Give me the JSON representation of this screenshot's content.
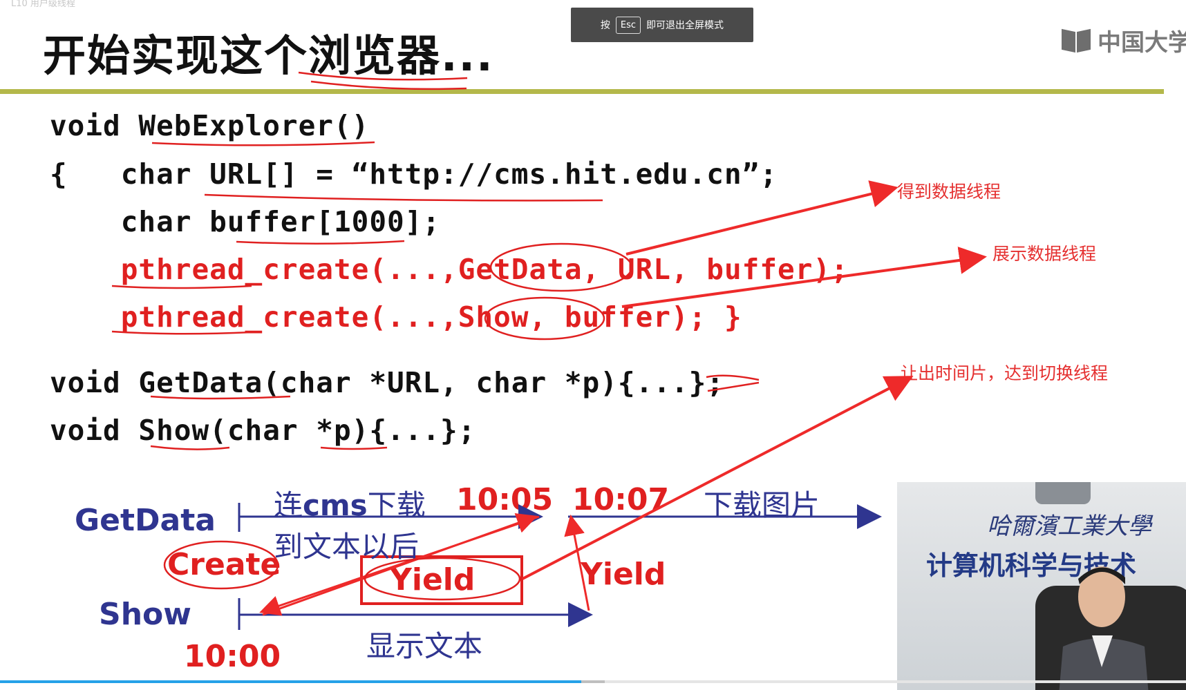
{
  "window": {
    "title": "L10 用户级线程"
  },
  "fullscreen_notice": {
    "prefix": "按",
    "key": "Esc",
    "suffix": "即可退出全屏模式"
  },
  "logo": {
    "text": "中国大学"
  },
  "slide": {
    "title": "开始实现这个浏览器...",
    "code_lines": [
      "void WebExplorer()",
      "{   char URL[] = “http://cms.hit.edu.cn”;",
      "    char buffer[1000];",
      "    pthread_create(...,GetData, URL, buffer);",
      "    pthread_create(...,Show, buffer); }",
      "void GetData(char *URL, char *p){...};",
      "void Show(char *p){...};"
    ],
    "annotations": [
      "得到数据线程",
      "展示数据线程",
      "让出时间片，达到切换线程"
    ],
    "diagram": {
      "getdata_label": "GetData",
      "show_label": "Show",
      "create_label": "Create",
      "yield_boxed": "Yield",
      "yield_right": "Yield",
      "lian": "连",
      "cms": "cms",
      "xiazai": "下载",
      "time_1005": "10:05",
      "time_1007": "10:07",
      "download_images": "下载图片",
      "after_text": "到文本以后",
      "display_text": "显示文本",
      "time_1000": "10:00"
    }
  },
  "video_inset": {
    "school_name": "哈爾濱工業大學",
    "department": "计算机科学与技术"
  },
  "colors": {
    "code_red": "#e02020",
    "diagram_blue": "#2f3590",
    "rule": "#b4b84a",
    "ink_red": "#e53030"
  },
  "playback": {
    "progress": 0.49,
    "buffered": 0.51
  }
}
